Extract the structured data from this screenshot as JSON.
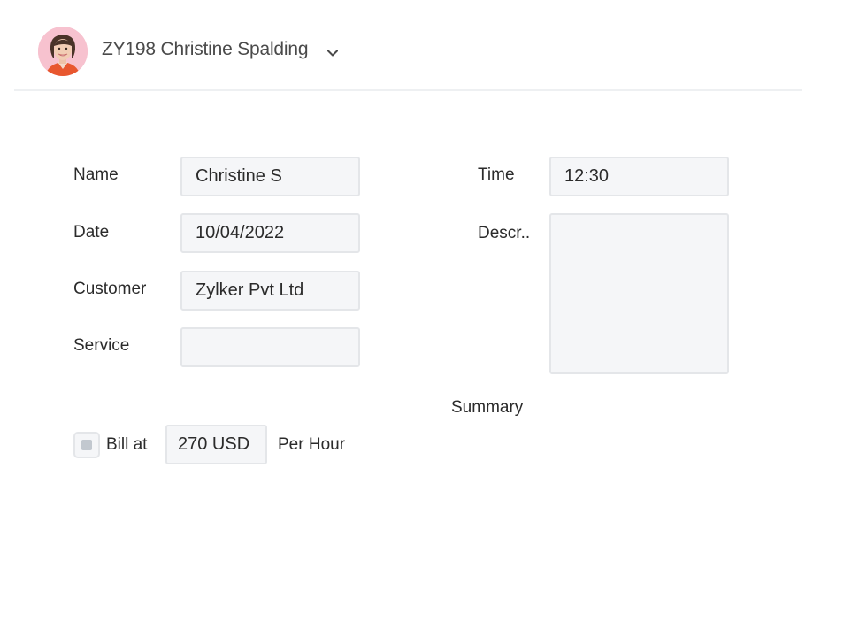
{
  "header": {
    "user_name": "ZY198 Christine Spalding",
    "avatar_icon": "user-avatar-photo",
    "dropdown_icon": "chevron-down-icon"
  },
  "form": {
    "name": {
      "label": "Name",
      "value": "Christine S"
    },
    "date": {
      "label": "Date",
      "value": "10/04/2022"
    },
    "customer": {
      "label": "Customer",
      "value": "Zylker Pvt Ltd"
    },
    "service": {
      "label": "Service",
      "value": ""
    },
    "time": {
      "label": "Time",
      "value": "12:30"
    },
    "description": {
      "label": "Descr..",
      "value": ""
    },
    "summary": {
      "label": "Summary"
    },
    "billing": {
      "checked": false,
      "prefix_label": "Bill at",
      "rate_value": "270 USD",
      "suffix_label": "Per Hour"
    }
  },
  "colors": {
    "field_background": "#f5f6f8",
    "field_border": "#e4e6e9",
    "avatar_background": "#f7c2cf"
  }
}
